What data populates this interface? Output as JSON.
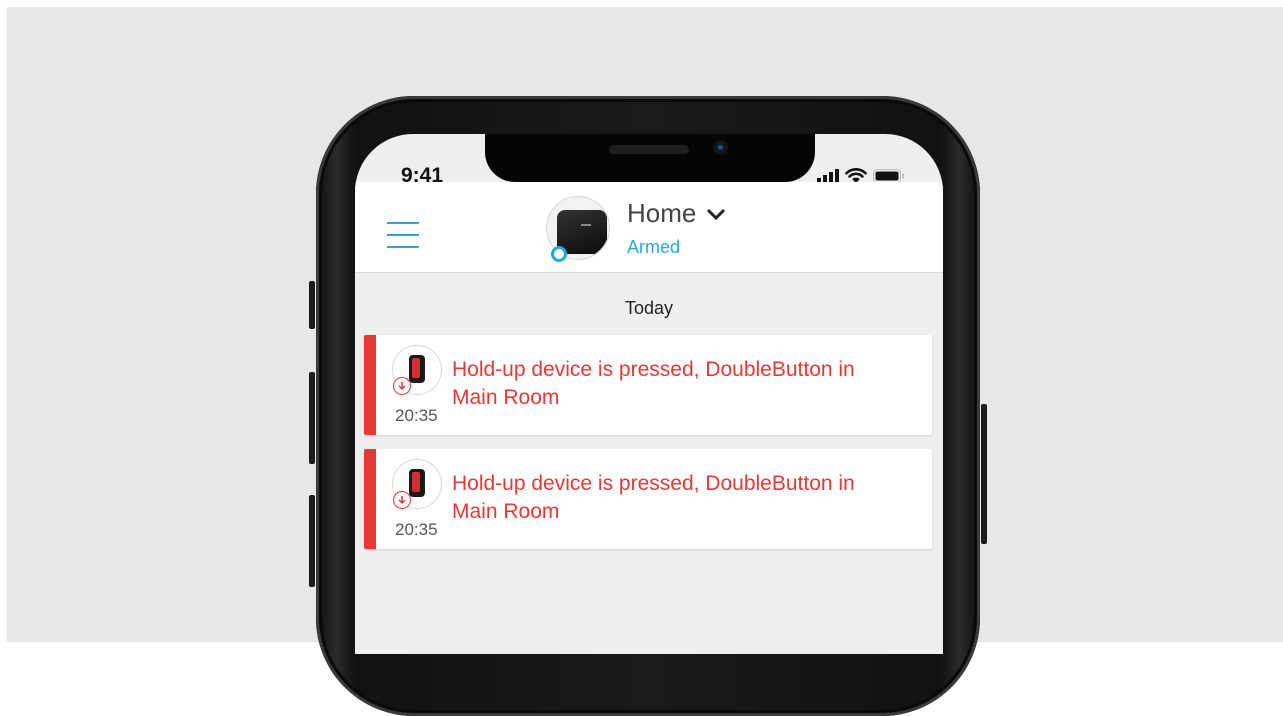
{
  "status_bar": {
    "time": "9:41"
  },
  "header": {
    "hub_name": "Home",
    "hub_status": "Armed",
    "accent_color": "#27a8e0"
  },
  "events": {
    "day_label": "Today",
    "accent_color": "#e53935",
    "items": [
      {
        "time": "20:35",
        "text": "Hold-up device is pressed, DoubleButton in Main Room",
        "icon": "doublebutton-icon",
        "badge": "alarm-down-arrow-icon"
      },
      {
        "time": "20:35",
        "text": "Hold-up device is pressed, DoubleButton in Main Room",
        "icon": "doublebutton-icon",
        "badge": "alarm-down-arrow-icon"
      }
    ]
  }
}
